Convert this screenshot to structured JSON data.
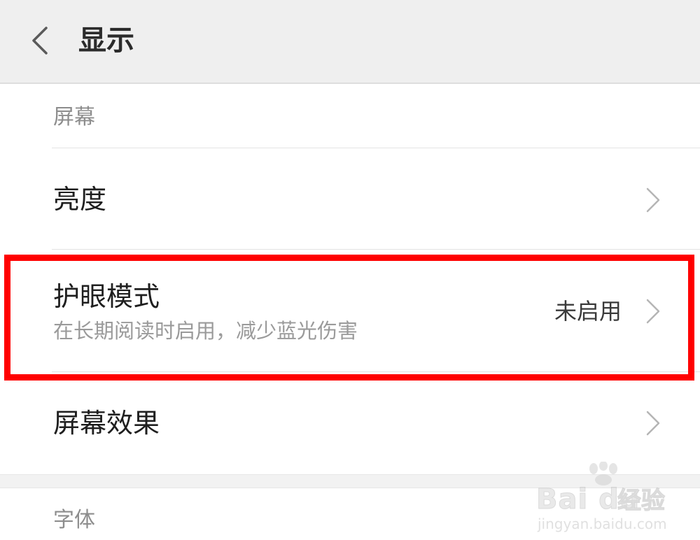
{
  "header": {
    "title": "显示",
    "back_icon": "chevron-left-icon"
  },
  "sections": {
    "screen_label": "屏幕",
    "font_label": "字体"
  },
  "rows": {
    "brightness": {
      "title": "亮度"
    },
    "eye_protection": {
      "title": "护眼模式",
      "subtitle": "在长期阅读时启用，减少蓝光伤害",
      "value": "未启用"
    },
    "screen_effect": {
      "title": "屏幕效果"
    }
  },
  "chevron_icon": "chevron-right-icon",
  "annotation": {
    "color": "#ff0000"
  },
  "watermark": {
    "brand": "Bai du",
    "chinese": "经验",
    "url": "jingyan.baidu.com"
  }
}
